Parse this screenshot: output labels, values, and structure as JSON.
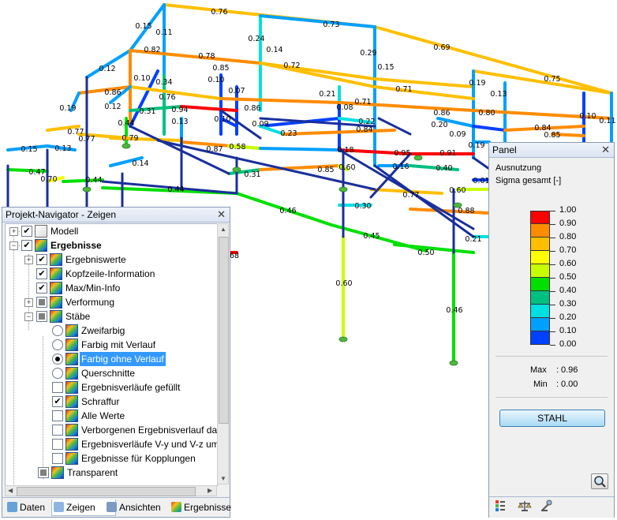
{
  "members": [
    {
      "label": "0.76"
    },
    {
      "label": "0.15"
    },
    {
      "label": "0.11"
    },
    {
      "label": "0.73"
    },
    {
      "label": "0.24"
    },
    {
      "label": "0.14"
    },
    {
      "label": "0.69"
    },
    {
      "label": "0.82"
    },
    {
      "label": "0.78"
    },
    {
      "label": "0.29"
    },
    {
      "label": "0.12"
    },
    {
      "label": "0.85"
    },
    {
      "label": "0.72"
    },
    {
      "label": "0.15"
    },
    {
      "label": "0.75"
    },
    {
      "label": "0.71"
    },
    {
      "label": "0.10"
    },
    {
      "label": "0.34"
    },
    {
      "label": "0.10"
    },
    {
      "label": "0.07"
    },
    {
      "label": "0.19"
    },
    {
      "label": "0.21"
    },
    {
      "label": "0.71"
    },
    {
      "label": "0.13"
    },
    {
      "label": "0.86"
    },
    {
      "label": "0.76"
    },
    {
      "label": "0.86"
    },
    {
      "label": "0.19"
    },
    {
      "label": "0.12"
    },
    {
      "label": "0.31"
    },
    {
      "label": "0.94"
    },
    {
      "label": "0.08"
    },
    {
      "label": "0.86"
    },
    {
      "label": "0.80"
    },
    {
      "label": "0.10"
    },
    {
      "label": "0.11"
    },
    {
      "label": "0.44"
    },
    {
      "label": "0.13"
    },
    {
      "label": "0.10"
    },
    {
      "label": "0.09"
    },
    {
      "label": "0.22"
    },
    {
      "label": "0.20"
    },
    {
      "label": "0.77"
    },
    {
      "label": "0.23"
    },
    {
      "label": "0.84"
    },
    {
      "label": "0.09"
    },
    {
      "label": "0.84"
    },
    {
      "label": "0.85"
    },
    {
      "label": "0.77"
    },
    {
      "label": "0.79"
    },
    {
      "label": "0.87"
    },
    {
      "label": "0.58"
    },
    {
      "label": "0.18"
    },
    {
      "label": "0.95"
    },
    {
      "label": "0.91"
    },
    {
      "label": "0.19"
    },
    {
      "label": "0.15"
    },
    {
      "label": "0.13"
    },
    {
      "label": "0.14"
    },
    {
      "label": "0.31"
    },
    {
      "label": "0.85"
    },
    {
      "label": "0.60"
    },
    {
      "label": "0.16"
    },
    {
      "label": "0.40"
    },
    {
      "label": "0.47"
    },
    {
      "label": "0.70"
    },
    {
      "label": "0.44"
    },
    {
      "label": "0.60"
    },
    {
      "label": "0.01"
    },
    {
      "label": "0.44"
    },
    {
      "label": "0.77"
    },
    {
      "label": "0.30"
    },
    {
      "label": "0.88"
    },
    {
      "label": "0.46"
    },
    {
      "label": "0.45"
    },
    {
      "label": "0.50"
    },
    {
      "label": "0.21"
    },
    {
      "label": "0.60"
    },
    {
      "label": "0.46"
    },
    {
      "label": "68"
    }
  ],
  "navigator": {
    "title": "Projekt-Navigator - Zeigen",
    "items": [
      {
        "label": "Modell",
        "checked": "✔"
      },
      {
        "label": "Ergebnisse",
        "checked": "✔"
      },
      {
        "label": "Ergebniswerte",
        "checked": "✔"
      },
      {
        "label": "Kopfzeile-Information",
        "checked": "✔"
      },
      {
        "label": "Max/Min-Info",
        "checked": "✔"
      },
      {
        "label": "Verformung",
        "checked": ""
      },
      {
        "label": "Stäbe",
        "checked": ""
      },
      {
        "label": "Zweifarbig"
      },
      {
        "label": "Farbig mit Verlauf"
      },
      {
        "label": "Farbig ohne Verlauf"
      },
      {
        "label": "Querschnitte"
      },
      {
        "label": "Ergebnisverläufe gefüllt",
        "checked": ""
      },
      {
        "label": "Schraffur",
        "checked": "✔"
      },
      {
        "label": "Alle Werte",
        "checked": ""
      },
      {
        "label": "Verborgenen Ergebnisverlauf dar",
        "checked": ""
      },
      {
        "label": "Ergebnisverläufe V-y und V-z um",
        "checked": ""
      },
      {
        "label": "Ergebnisse für Kopplungen",
        "checked": ""
      },
      {
        "label": "Transparent",
        "checked": ""
      }
    ],
    "tabs": [
      "Daten",
      "Zeigen",
      "Ansichten",
      "Ergebnisse"
    ]
  },
  "panel": {
    "title": "Panel",
    "line1": "Ausnutzung",
    "line2": "Sigma gesamt [-]",
    "scale": [
      {
        "value": "1.00",
        "color": "#ff0000"
      },
      {
        "value": "0.90",
        "color": "#ff8c00"
      },
      {
        "value": "0.80",
        "color": "#ffbf00"
      },
      {
        "value": "0.70",
        "color": "#ffff00"
      },
      {
        "value": "0.60",
        "color": "#c8ff00"
      },
      {
        "value": "0.50",
        "color": "#00e000"
      },
      {
        "value": "0.40",
        "color": "#00c080"
      },
      {
        "value": "0.30",
        "color": "#00e0e0"
      },
      {
        "value": "0.20",
        "color": "#00a0ff"
      },
      {
        "value": "0.10",
        "color": "#0040ff"
      },
      {
        "value": "0.00",
        "color": "#0000a0"
      }
    ],
    "max_label": "Max",
    "max_value": "0.96",
    "min_label": "Min",
    "min_value": "0.00",
    "button": "STAHL"
  },
  "colors": {
    "accent": "#3399ff"
  }
}
